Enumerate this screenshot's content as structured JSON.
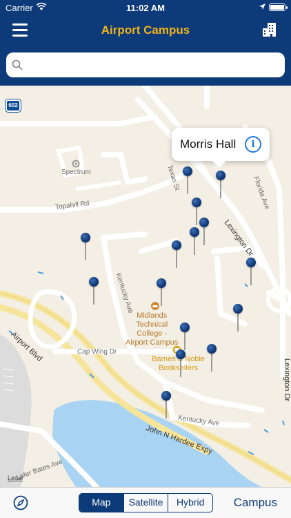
{
  "status_bar": {
    "carrier": "Carrier",
    "time": "11:02 AM"
  },
  "nav": {
    "title": "Airport Campus",
    "title_color": "#f2b31a",
    "bar_color": "#0d3a78",
    "menu_icon": "hamburger-menu-icon",
    "right_icon": "buildings-icon"
  },
  "search": {
    "value": "",
    "placeholder": ""
  },
  "map": {
    "route_shield": "602",
    "labels": {
      "spectrum": "Spectrum",
      "topahill": "Topahill Rd",
      "texas": "Texas St",
      "florida": "Florida Ave",
      "lexington_dr": "Lexington Dr",
      "lexington_dr_2": "Lexington Dr",
      "kentucky_ave": "Kentucky Ave",
      "kentucky_ave_2": "Kentucky Ave",
      "cap_wing": "Cap Wing Dr",
      "airport_blvd": "Airport Blvd",
      "hardee": "John N Hardee Expy",
      "bates": "Lafer Bates Ave"
    },
    "pois": {
      "midlands": "Midlands\nTechnical\nCollege -\nAirport Campus",
      "barnes": "Barnes & Noble\nBooksellers"
    },
    "legal": "Legal",
    "pin_count": 15
  },
  "callout": {
    "name": "Morris Hall",
    "info_glyph": "i"
  },
  "bottom": {
    "compass_icon": "compass-icon",
    "segments": [
      "Map",
      "Satellite",
      "Hybrid"
    ],
    "active_segment": "Map",
    "campus_label": "Campus"
  }
}
